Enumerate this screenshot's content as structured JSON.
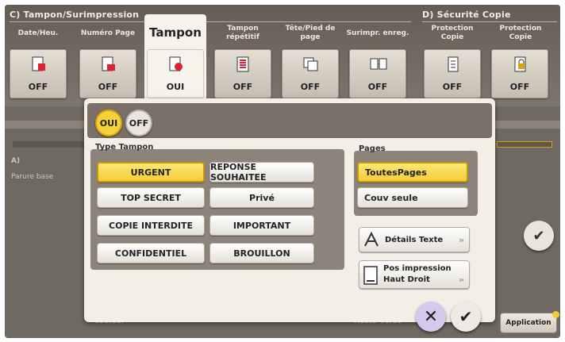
{
  "groups": {
    "left": "C)  Tampon/Surimpression",
    "right": "D)  Sécurité Copie"
  },
  "tabs": [
    {
      "label": "Date/Heu.",
      "value": "OFF",
      "icon": "date-stamp-icon"
    },
    {
      "label": "Numéro Page",
      "value": "OFF",
      "icon": "page-number-icon"
    },
    {
      "label": "Tampon",
      "value": "OUI",
      "icon": "stamp-icon"
    },
    {
      "label": "Tampon répétitif",
      "value": "OFF",
      "icon": "repeat-stamp-icon"
    },
    {
      "label": "Tête/Pied de page",
      "value": "OFF",
      "icon": "header-footer-icon"
    },
    {
      "label": "Surimpr. enreg.",
      "value": "OFF",
      "icon": "overlay-icon"
    },
    {
      "label": "Protection Copie",
      "value": "OFF",
      "icon": "copy-protect-icon"
    },
    {
      "label": "Protection Copie",
      "value": "OFF",
      "icon": "lock-copy-icon"
    }
  ],
  "background": {
    "section_a": "A)",
    "left_text": "Parure base",
    "bottom_left": "Couleur",
    "bottom_right": "Recto-verso",
    "application": "Application"
  },
  "toggle": {
    "on": "OUI",
    "off": "OFF"
  },
  "stamp_type": {
    "label": "Type Tampon",
    "options": [
      {
        "label": "URGENT",
        "selected": true
      },
      {
        "label": "REPONSE SOUHAITEE",
        "selected": false
      },
      {
        "label": "TOP SECRET",
        "selected": false
      },
      {
        "label": "Privé",
        "selected": false
      },
      {
        "label": "COPIE INTERDITE",
        "selected": false
      },
      {
        "label": "IMPORTANT",
        "selected": false
      },
      {
        "label": "CONFIDENTIEL",
        "selected": false
      },
      {
        "label": "BROUILLON",
        "selected": false
      }
    ]
  },
  "pages": {
    "label": "Pages",
    "options": [
      {
        "label": "ToutesPages",
        "selected": true
      },
      {
        "label": "Couv seule",
        "selected": false
      }
    ]
  },
  "details": {
    "text_details": "Détails Texte",
    "position_title": "Pos impression",
    "position_value": "Haut Droit"
  },
  "colors": {
    "accent": "#f2cd33",
    "cancel": "#cfc3ea"
  }
}
